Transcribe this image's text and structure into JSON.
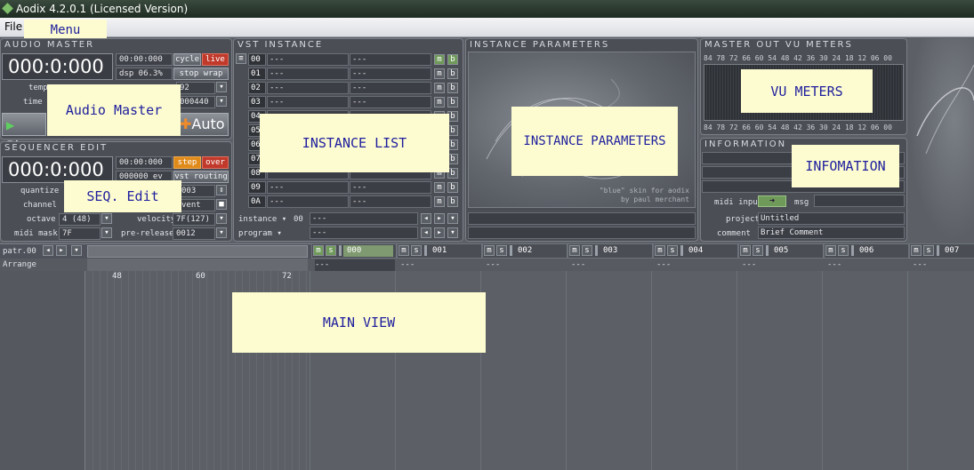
{
  "window": {
    "title": "Aodix 4.2.0.1 (Licensed Version)"
  },
  "menu": {
    "file_label": "File"
  },
  "annotations": {
    "menu": "Menu",
    "audio_master": "Audio Master",
    "seq_edit": "SEQ. Edit",
    "instance_list": "INSTANCE LIST",
    "instance_parameters": "INSTANCE PARAMETERS",
    "vu_meters": "VU METERS",
    "information": "INFOMATION",
    "main_view": "MAIN VIEW"
  },
  "audio_master": {
    "title": "AUDIO MASTER",
    "position": "000:0:000",
    "time": "00:00:000",
    "cycle": "cycle",
    "live": "live",
    "dsp": "dsp 06.3%",
    "stop_wrap": "stop wrap",
    "tempo_label": "temp",
    "tempo_value": "92",
    "timesig_label": "time s",
    "timesig_value": "000440",
    "play": "Play",
    "auto": "Auto"
  },
  "sequencer_edit": {
    "title": "SEQUENCER EDIT",
    "position": "000:0:000",
    "time": "00:00:000",
    "step": "step",
    "over": "over",
    "ev": "000000 ev",
    "vst_routing": "vst routing",
    "quantize_label": "quantize",
    "quantize_value": "003",
    "channel_label": "channel",
    "channel_value": "vent",
    "octave_label": "octave",
    "octave_value": "4 (48)",
    "velocity_label": "velocity",
    "velocity_value": "7F(127)",
    "midimask_label": "midi mask",
    "midimask_value": "7F",
    "prerelease_label": "pre-release",
    "prerelease_value": "0012"
  },
  "vst_instance": {
    "title": "VST INSTANCE",
    "rows": [
      {
        "num": "00",
        "name": "---",
        "param": "---"
      },
      {
        "num": "01",
        "name": "---",
        "param": "---"
      },
      {
        "num": "02",
        "name": "---",
        "param": "---"
      },
      {
        "num": "03",
        "name": "---",
        "param": "---"
      },
      {
        "num": "04",
        "name": "",
        "param": ""
      },
      {
        "num": "05",
        "name": "",
        "param": ""
      },
      {
        "num": "06",
        "name": "",
        "param": ""
      },
      {
        "num": "07",
        "name": "",
        "param": ""
      },
      {
        "num": "08",
        "name": "",
        "param": ""
      },
      {
        "num": "09",
        "name": "---",
        "param": "---"
      },
      {
        "num": "0A",
        "name": "---",
        "param": "---"
      }
    ],
    "m": "m",
    "b": "b",
    "instance_label": "instance",
    "instance_value": "00",
    "instance_name": "---",
    "program_label": "program",
    "program_name": "---"
  },
  "instance_parameters": {
    "title": "INSTANCE PARAMETERS",
    "credit1": "\"blue\" skin for aodix",
    "credit2": "by paul merchant"
  },
  "vu_meters": {
    "title": "MASTER OUT VU METERS",
    "scale": "84 78 72 66 60 54 48 42 36 30 24 18 12 06 00"
  },
  "information": {
    "title": "INFORMATION",
    "midi_input_label": "midi input",
    "msg_label": "msg",
    "project_label": "project",
    "project_value": "Untitled",
    "comment_label": "comment",
    "comment_value": "Brief Comment"
  },
  "pattern": {
    "label": "patr.",
    "value": "00",
    "arrange_label": "Arrange",
    "empty": "---",
    "ruler": [
      "48",
      "60",
      "72"
    ]
  },
  "tracks": [
    {
      "num": "000"
    },
    {
      "num": "001"
    },
    {
      "num": "002"
    },
    {
      "num": "003"
    },
    {
      "num": "004"
    },
    {
      "num": "005"
    },
    {
      "num": "006"
    },
    {
      "num": "007"
    }
  ],
  "colors": {
    "panel": "#4b4e55",
    "background": "#5c5f66",
    "accent_red": "#c0392b",
    "accent_orange": "#e08a1a",
    "note_yellow": "#fdfcd0"
  }
}
